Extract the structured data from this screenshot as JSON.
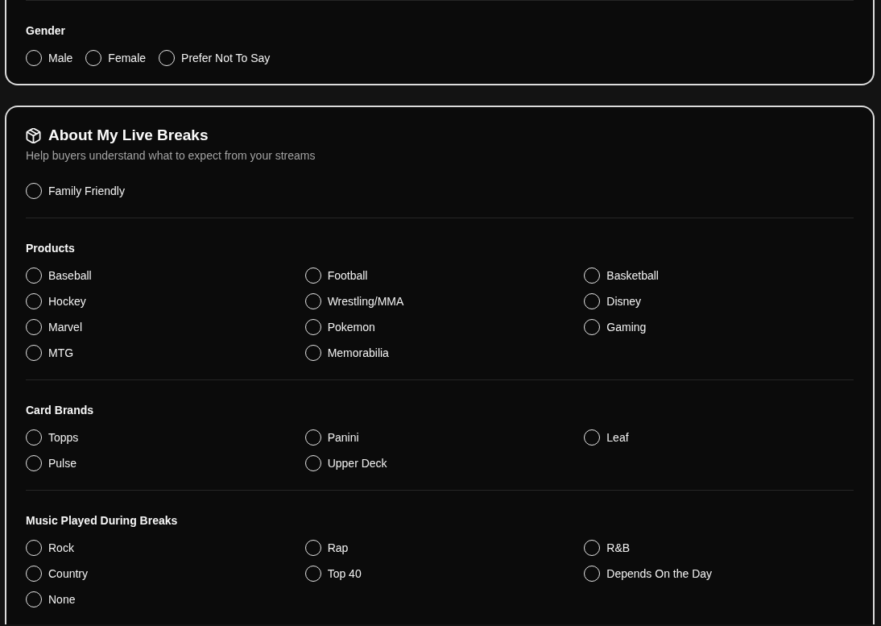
{
  "profile_section": {
    "groups": [
      {
        "label": "Gender",
        "kind": "inline",
        "options": [
          {
            "label": "Male",
            "selected": false
          },
          {
            "label": "Female",
            "selected": false
          },
          {
            "label": "Prefer Not To Say",
            "selected": false
          }
        ]
      }
    ]
  },
  "live_breaks": {
    "title": "About My Live Breaks",
    "subtitle": "Help buyers understand what to expect from your streams",
    "groups": [
      {
        "kind": "inline",
        "options": [
          {
            "label": "Family Friendly",
            "checked": false
          }
        ]
      },
      {
        "label": "Products",
        "kind": "grid",
        "options": [
          {
            "label": "Baseball",
            "checked": false
          },
          {
            "label": "Football",
            "checked": false
          },
          {
            "label": "Basketball",
            "checked": false
          },
          {
            "label": "Hockey",
            "checked": false
          },
          {
            "label": "Wrestling/MMA",
            "checked": false
          },
          {
            "label": "Disney",
            "checked": false
          },
          {
            "label": "Marvel",
            "checked": false
          },
          {
            "label": "Pokemon",
            "checked": false
          },
          {
            "label": "Gaming",
            "checked": false
          },
          {
            "label": "MTG",
            "checked": false
          },
          {
            "label": "Memorabilia",
            "checked": false
          }
        ]
      },
      {
        "label": "Card Brands",
        "kind": "grid",
        "options": [
          {
            "label": "Topps",
            "checked": false
          },
          {
            "label": "Panini",
            "checked": false
          },
          {
            "label": "Leaf",
            "checked": false
          },
          {
            "label": "Pulse",
            "checked": false
          },
          {
            "label": "Upper Deck",
            "checked": false
          }
        ]
      },
      {
        "label": "Music Played During Breaks",
        "kind": "grid",
        "options": [
          {
            "label": "Rock",
            "checked": false
          },
          {
            "label": "Rap",
            "checked": false
          },
          {
            "label": "R&B",
            "checked": false
          },
          {
            "label": "Country",
            "checked": false
          },
          {
            "label": "Top 40",
            "checked": false
          },
          {
            "label": "Depends On the Day",
            "checked": false
          },
          {
            "label": "None",
            "checked": false
          }
        ]
      }
    ]
  }
}
